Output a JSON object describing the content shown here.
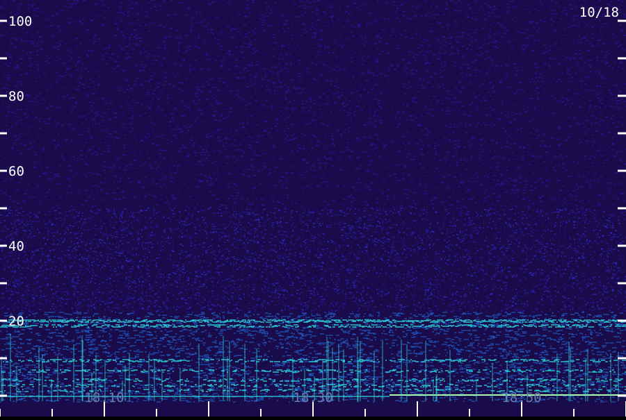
{
  "chart_data": {
    "type": "heatmap",
    "date_label": "10/18",
    "y_ticks": [
      "100",
      "80",
      "60",
      "40",
      "20"
    ],
    "x_ticks": [
      "18:10",
      "18:30",
      "18:50"
    ],
    "ylim": [
      0,
      100
    ],
    "colors": {
      "background": "#1a0b4a",
      "low": "#2a18a0",
      "mid": "#1f6ad8",
      "high": "#2fe0e0",
      "peak": "#aaffaa",
      "axis": "#ffffff"
    }
  }
}
